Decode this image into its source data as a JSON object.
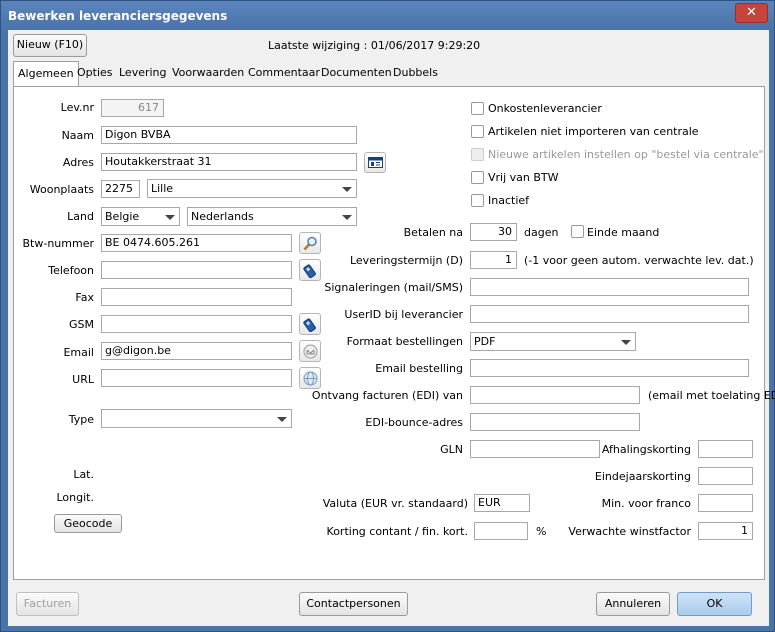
{
  "window": {
    "title": "Bewerken leveranciersgegevens",
    "close_label": "✕"
  },
  "header": {
    "new_button": "Nieuw (F10)",
    "last_modified": "Laatste wijziging :  01/06/2017 9:29:20"
  },
  "tabs": [
    "Algemeen",
    "Opties",
    "Levering",
    "Voorwaarden",
    "Commentaar",
    "Documenten",
    "Dubbels"
  ],
  "left": {
    "levnr_label": "Lev.nr",
    "levnr_value": "617",
    "naam_label": "Naam",
    "naam_value": "Digon BVBA",
    "adres_label": "Adres",
    "adres_value": "Houtakkerstraat 31",
    "woonplaats_label": "Woonplaats",
    "postcode_value": "2275",
    "gemeente_value": "Lille",
    "land_label": "Land",
    "land_value": "Belgie",
    "taal_value": "Nederlands",
    "btw_label": "Btw-nummer",
    "btw_value": "BE 0474.605.261",
    "telefoon_label": "Telefoon",
    "telefoon_value": "",
    "fax_label": "Fax",
    "fax_value": "",
    "gsm_label": "GSM",
    "gsm_value": "",
    "email_label": "Email",
    "email_value": "g@digon.be",
    "url_label": "URL",
    "url_value": "",
    "type_label": "Type",
    "type_value": "",
    "lat_label": "Lat.",
    "longit_label": "Longit.",
    "geocode_button": "Geocode"
  },
  "checks": [
    {
      "label": "Onkostenleverancier",
      "checked": false,
      "disabled": false
    },
    {
      "label": "Artikelen niet importeren van centrale",
      "checked": false,
      "disabled": false
    },
    {
      "label": "Nieuwe artikelen instellen op \"bestel via centrale\"",
      "checked": false,
      "disabled": true
    },
    {
      "label": "Vrij van BTW",
      "checked": false,
      "disabled": false
    },
    {
      "label": "Inactief",
      "checked": false,
      "disabled": false
    }
  ],
  "right": {
    "betalen_label": "Betalen na",
    "betalen_value": "30",
    "dagen_label": "dagen",
    "einde_maand_label": "Einde maand",
    "leveringstermijn_label": "Leveringstermijn (D)",
    "leveringstermijn_value": "1",
    "leveringstermijn_hint": "(-1 voor geen autom. verwachte lev. dat.)",
    "signaleringen_label": "Signaleringen (mail/SMS)",
    "signaleringen_value": "",
    "userid_label": "UserID bij leverancier",
    "userid_value": "",
    "formaat_label": "Formaat bestellingen",
    "formaat_value": "PDF",
    "email_bestelling_label": "Email bestelling",
    "email_bestelling_value": "",
    "ontvang_label": "Ontvang facturen (EDI) van",
    "ontvang_value": "",
    "ontvang_hint": "(email met toelating EDI",
    "edi_bounce_label": "EDI-bounce-adres",
    "edi_bounce_value": "",
    "gln_label": "GLN",
    "gln_value": "",
    "afhaling_label": "Afhalingskorting",
    "afhaling_value": "",
    "eindejaar_label": "Eindejaarskorting",
    "eindejaar_value": "",
    "valuta_label": "Valuta (EUR vr. standaard)",
    "valuta_value": "EUR",
    "min_franco_label": "Min. voor franco",
    "min_franco_value": "",
    "korting_label": "Korting contant / fin. kort.",
    "korting_value": "",
    "pct_label": "%",
    "winstfactor_label": "Verwachte winstfactor",
    "winstfactor_value": "1"
  },
  "footer": {
    "facturen": "Facturen",
    "contactpersonen": "Contactpersonen",
    "annuleren": "Annuleren",
    "ok": "OK"
  }
}
